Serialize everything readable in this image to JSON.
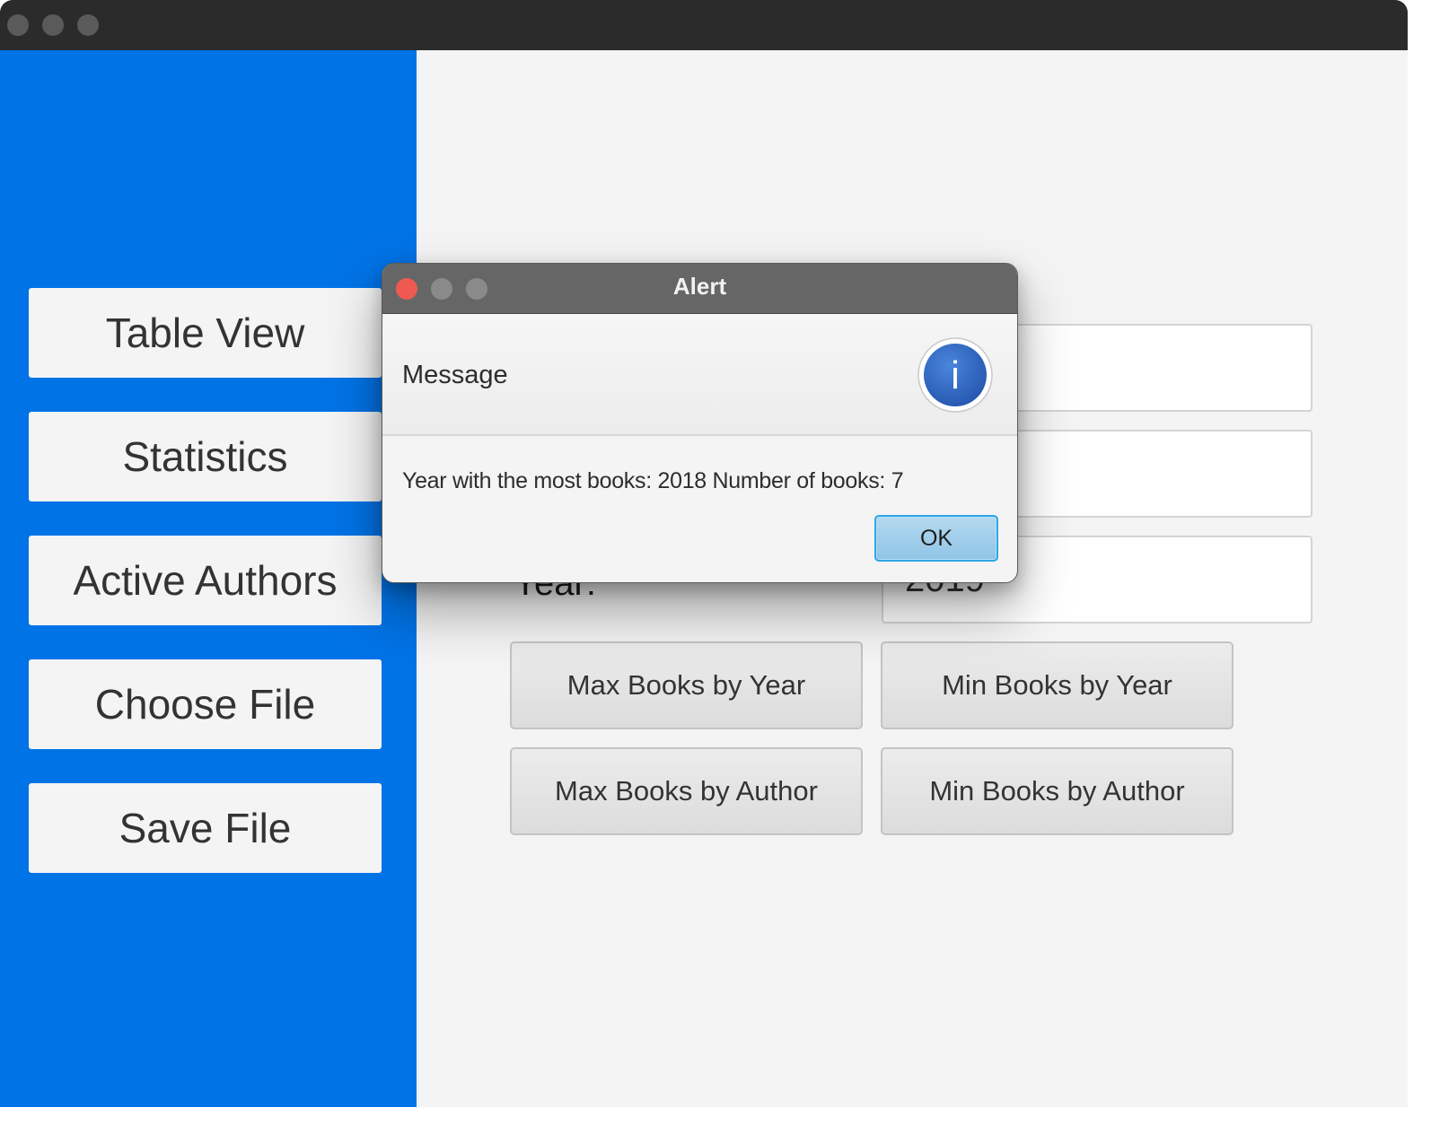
{
  "sidebar": {
    "items": [
      {
        "label": "Table View"
      },
      {
        "label": "Statistics"
      },
      {
        "label": "Active Authors"
      },
      {
        "label": "Choose File"
      },
      {
        "label": "Save File"
      }
    ]
  },
  "form": {
    "year_label": "Year:",
    "field1_value": "",
    "field2_value": "",
    "year_value": "2019"
  },
  "actions": {
    "max_by_year": "Max Books by Year",
    "min_by_year": "Min Books by Year",
    "max_by_author": "Max Books by Author",
    "min_by_author": "Min Books by Author"
  },
  "alert": {
    "title": "Alert",
    "header": "Message",
    "icon": "info-icon",
    "icon_glyph": "i",
    "content": "Year with the most books: 2018 Number of books: 7",
    "ok_label": "OK"
  },
  "colors": {
    "sidebar": "#0073e6",
    "ok_button": "#9fcde9",
    "info_icon": "#2f6bc4"
  }
}
